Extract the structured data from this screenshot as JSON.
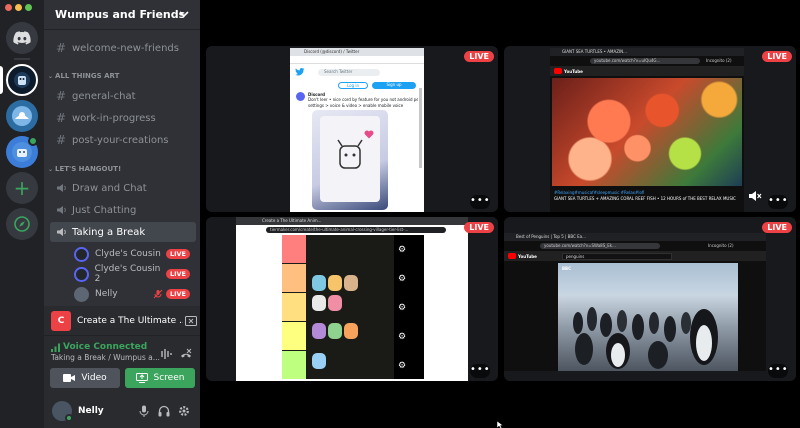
{
  "guild": {
    "name": "Wumpus and Friends"
  },
  "channels": {
    "top": {
      "label": "welcome-new-friends"
    },
    "cat_art": {
      "label": "ALL THINGS ART"
    },
    "art": [
      {
        "label": "general-chat"
      },
      {
        "label": "work-in-progress"
      },
      {
        "label": "post-your-creations"
      }
    ],
    "cat_hangout": {
      "label": "LET'S HANGOUT!"
    },
    "voice": [
      {
        "label": "Draw and Chat"
      },
      {
        "label": "Just Chatting"
      },
      {
        "label": "Taking a Break"
      }
    ],
    "voice_users": [
      {
        "name": "Clyde's Cousin",
        "badge": "LIVE"
      },
      {
        "name": "Clyde's Cousin 2",
        "badge": "LIVE"
      },
      {
        "name": "Nelly",
        "badge": "LIVE"
      }
    ]
  },
  "stream": {
    "thumb": "C",
    "title": "Create a The Ultimate ..."
  },
  "voice": {
    "status": "Voice Connected",
    "sub": "Taking a Break / Wumpus a...",
    "video_label": "Video",
    "screen_label": "Screen"
  },
  "user": {
    "name": "Nelly"
  },
  "tiles": {
    "live": "LIVE",
    "more": "•••",
    "twitter": {
      "tab": "Discord (@discord) / Twitter",
      "search": "Search Twitter",
      "login": "Log in",
      "signup": "Sign up",
      "account": "Discord",
      "tweet": "Don't leer • nice cord by feature for you not android peoples",
      "nav": "settings > voice & video > enable mobile voice"
    },
    "youtube": {
      "tab": "GIANT SEA TURTLES • AMAZIN...",
      "url": "youtube.com/watch?v=uIQu4G...",
      "brand": "YouTube",
      "profile": "Incognito (2)",
      "caption_tags": "#Relaxing#musicaf#sleepmusic #Relax#lofi",
      "caption": "GIANT SEA TURTLES + AMAZING CORAL REEF FISH • 12 HOURS of THE BEST RELAX MUSIC"
    },
    "tierlist": {
      "tab": "Create a The Ultimate Anim...",
      "url": "tiermaker.com/create/the-ultimate-animal-crossing-villager-tier-list-..."
    },
    "penguins": {
      "tab": "Best of Penguins | Top 5 | BBC Ea...",
      "url": "youtube.com/watch?v=SWa8S_Ek...",
      "brand": "YouTube",
      "search": "penguins",
      "profile": "Incognito (2)",
      "watermark": "BBC"
    }
  },
  "colors": {
    "blurple": "#5865f2",
    "green": "#3ba55d",
    "red": "#ed4245",
    "sidebar": "#2f3136",
    "rail": "#202225"
  }
}
